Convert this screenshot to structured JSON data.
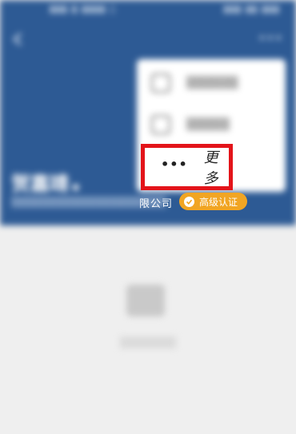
{
  "status_bar": {
    "left_text": "▮▮▮ ▮ ▮▮▮▮ ▯",
    "right_text": "▮▮▮ ▮▮ ▮▮▮"
  },
  "header": {
    "name": "贺嘉靖",
    "name_suffix": "▪",
    "subtitle": "▒▒▒▒▒▒▒▒▒▒▒▒▒▒▒▒▒▒▒▒▒",
    "company_tail": "限公司",
    "cert_badge": "高级认证",
    "colors": {
      "header_bg": "#2d5a94",
      "badge": "#f1a523",
      "highlight": "#e3141a"
    }
  },
  "popup": {
    "items": [
      {
        "label": "▒▒▒▒▒▒",
        "icon": "edit-icon"
      },
      {
        "label": "▒▒▒▒▒",
        "icon": "share-icon"
      }
    ],
    "more": {
      "dots": "•••",
      "label": "更多"
    }
  },
  "empty_state": {
    "text": "▒▒▒▒▒▒▒"
  }
}
